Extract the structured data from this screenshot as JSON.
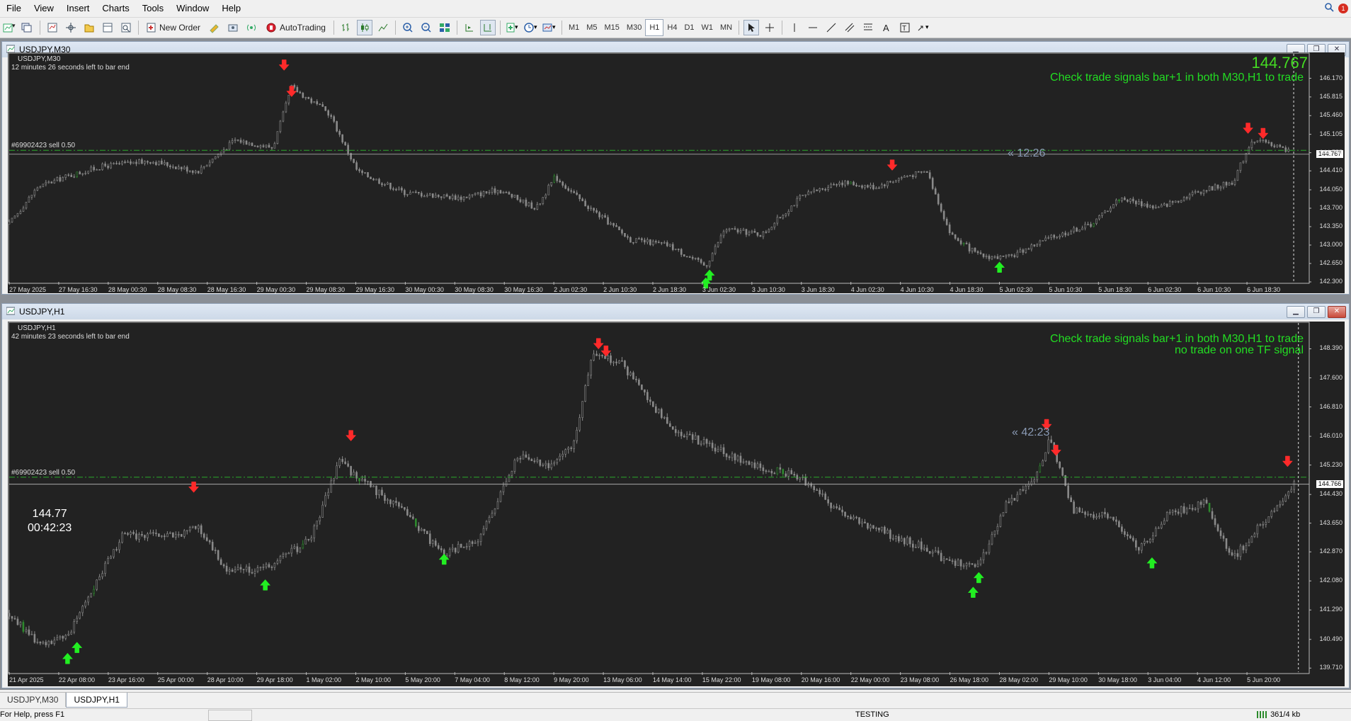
{
  "menu": [
    "File",
    "View",
    "Insert",
    "Charts",
    "Tools",
    "Window",
    "Help"
  ],
  "toolbar": {
    "new_order": "New Order",
    "autotrading": "AutoTrading",
    "timeframes": [
      "M1",
      "M5",
      "M15",
      "M30",
      "H1",
      "H4",
      "D1",
      "W1",
      "MN"
    ],
    "active_timeframe": "H1",
    "notification_count": "1"
  },
  "windows": [
    {
      "title": "USDJPY,M30",
      "symbol": "USDJPY,M30",
      "time_left": "12 minutes 26 seconds left to bar end",
      "order_label": "#69902423 sell 0.50",
      "big_price": "144.767",
      "signal_lines": [
        "Check trade signals bar+1 in both M30,H1 to trade"
      ],
      "countdown": "« 12:26",
      "current_price_tag": "144.767",
      "price_axis": [
        "146.170",
        "145.815",
        "145.460",
        "145.105",
        "144.755",
        "144.410",
        "144.050",
        "143.700",
        "143.350",
        "143.000",
        "142.650",
        "142.300"
      ],
      "time_axis": [
        "27 May 2025",
        "27 May 16:30",
        "28 May 00:30",
        "28 May 08:30",
        "28 May 16:30",
        "29 May 00:30",
        "29 May 08:30",
        "29 May 16:30",
        "30 May 00:30",
        "30 May 08:30",
        "30 May 16:30",
        "2 Jun 02:30",
        "2 Jun 10:30",
        "2 Jun 18:30",
        "3 Jun 02:30",
        "3 Jun 10:30",
        "3 Jun 18:30",
        "4 Jun 02:30",
        "4 Jun 10:30",
        "4 Jun 18:30",
        "5 Jun 02:30",
        "5 Jun 10:30",
        "5 Jun 18:30",
        "6 Jun 02:30",
        "6 Jun 10:30",
        "6 Jun 18:30"
      ],
      "corner_price": "",
      "corner_time": ""
    },
    {
      "title": "USDJPY,H1",
      "symbol": "USDJPY,H1",
      "time_left": "42 minutes 23 seconds left to bar end",
      "order_label": "#69902423 sell 0.50",
      "big_price": "",
      "signal_lines": [
        "Check trade signals bar+1 in both M30,H1 to trade",
        "no trade on one TF signal"
      ],
      "countdown": "« 42:23",
      "current_price_tag": "144.766",
      "price_axis": [
        "148.390",
        "147.600",
        "146.810",
        "146.010",
        "145.230",
        "144.430",
        "143.650",
        "142.870",
        "142.080",
        "141.290",
        "140.490",
        "139.710"
      ],
      "time_axis": [
        "21 Apr 2025",
        "22 Apr 08:00",
        "23 Apr 16:00",
        "25 Apr 00:00",
        "28 Apr 10:00",
        "29 Apr 18:00",
        "1 May 02:00",
        "2 May 10:00",
        "5 May 20:00",
        "7 May 04:00",
        "8 May 12:00",
        "9 May 20:00",
        "13 May 06:00",
        "14 May 14:00",
        "15 May 22:00",
        "19 May 08:00",
        "20 May 16:00",
        "22 May 00:00",
        "23 May 08:00",
        "26 May 18:00",
        "28 May 02:00",
        "29 May 10:00",
        "30 May 18:00",
        "3 Jun 04:00",
        "4 Jun 12:00",
        "5 Jun 20:00"
      ],
      "corner_price": "144.77",
      "corner_time": "00:42:23"
    }
  ],
  "tabs": [
    "USDJPY,M30",
    "USDJPY,H1"
  ],
  "status": {
    "help": "For Help, press F1",
    "mode": "TESTING",
    "traffic": "361/4 kb"
  },
  "chart_data": [
    {
      "type": "candlestick",
      "symbol": "USDJPY",
      "timeframe": "M30",
      "ylim": [
        142.3,
        146.5
      ],
      "y_ticks": [
        146.17,
        145.815,
        145.46,
        145.105,
        144.755,
        144.41,
        144.05,
        143.7,
        143.35,
        143.0,
        142.65,
        142.3
      ],
      "x_tick_labels": [
        "27 May 2025",
        "27 May 16:30",
        "28 May 00:30",
        "28 May 08:30",
        "28 May 16:30",
        "29 May 00:30",
        "29 May 08:30",
        "29 May 16:30",
        "30 May 00:30",
        "30 May 08:30",
        "30 May 16:30",
        "2 Jun 02:30",
        "2 Jun 10:30",
        "2 Jun 18:30",
        "3 Jun 02:30",
        "3 Jun 10:30",
        "3 Jun 18:30",
        "4 Jun 02:30",
        "4 Jun 10:30",
        "4 Jun 18:30",
        "5 Jun 02:30",
        "5 Jun 10:30",
        "5 Jun 18:30",
        "6 Jun 02:30",
        "6 Jun 10:30",
        "6 Jun 18:30"
      ],
      "price_path": [
        [
          0,
          143.4
        ],
        [
          30,
          144.1
        ],
        [
          60,
          144.3
        ],
        [
          100,
          144.5
        ],
        [
          150,
          144.6
        ],
        [
          200,
          144.4
        ],
        [
          240,
          145.0
        ],
        [
          280,
          144.85
        ],
        [
          300,
          146.0
        ],
        [
          340,
          145.5
        ],
        [
          370,
          144.4
        ],
        [
          420,
          144.0
        ],
        [
          480,
          143.9
        ],
        [
          520,
          144.05
        ],
        [
          560,
          143.7
        ],
        [
          580,
          144.3
        ],
        [
          610,
          143.8
        ],
        [
          660,
          143.1
        ],
        [
          700,
          143.0
        ],
        [
          740,
          142.6
        ],
        [
          760,
          143.3
        ],
        [
          800,
          143.2
        ],
        [
          840,
          143.9
        ],
        [
          880,
          144.2
        ],
        [
          920,
          144.1
        ],
        [
          950,
          144.3
        ],
        [
          975,
          144.4
        ],
        [
          1000,
          143.2
        ],
        [
          1030,
          142.8
        ],
        [
          1060,
          142.75
        ],
        [
          1100,
          143.1
        ],
        [
          1150,
          143.4
        ],
        [
          1180,
          143.9
        ],
        [
          1220,
          143.7
        ],
        [
          1260,
          144.0
        ],
        [
          1300,
          144.2
        ],
        [
          1320,
          145.0
        ],
        [
          1345,
          144.9
        ],
        [
          1360,
          144.77
        ]
      ],
      "order_line": 144.8,
      "current_price": 144.767,
      "signals": [
        {
          "type": "sell",
          "x": 292,
          "y": 146.4
        },
        {
          "type": "sell",
          "x": 300,
          "y": 145.9
        },
        {
          "type": "sell",
          "x": 938,
          "y": 144.5
        },
        {
          "type": "buy",
          "x": 744,
          "y": 142.45
        },
        {
          "type": "buy",
          "x": 740,
          "y": 142.3
        },
        {
          "type": "buy",
          "x": 1052,
          "y": 142.6
        },
        {
          "type": "sell",
          "x": 1316,
          "y": 145.2
        },
        {
          "type": "sell",
          "x": 1332,
          "y": 145.1
        }
      ]
    },
    {
      "type": "candlestick",
      "symbol": "USDJPY",
      "timeframe": "H1",
      "ylim": [
        139.6,
        148.9
      ],
      "y_ticks": [
        148.39,
        147.6,
        146.81,
        146.01,
        145.23,
        144.43,
        143.65,
        142.87,
        142.08,
        141.29,
        140.49,
        139.71
      ],
      "x_tick_labels": [
        "21 Apr 2025",
        "22 Apr 08:00",
        "23 Apr 16:00",
        "25 Apr 00:00",
        "28 Apr 10:00",
        "29 Apr 18:00",
        "1 May 02:00",
        "2 May 10:00",
        "5 May 20:00",
        "7 May 04:00",
        "8 May 12:00",
        "9 May 20:00",
        "13 May 06:00",
        "14 May 14:00",
        "15 May 22:00",
        "19 May 08:00",
        "20 May 16:00",
        "22 May 00:00",
        "23 May 08:00",
        "26 May 18:00",
        "28 May 02:00",
        "29 May 10:00",
        "30 May 18:00",
        "3 Jun 04:00",
        "4 Jun 12:00",
        "5 Jun 20:00"
      ],
      "price_path": [
        [
          0,
          141.2
        ],
        [
          30,
          140.4
        ],
        [
          60,
          140.5
        ],
        [
          80,
          141.5
        ],
        [
          120,
          143.3
        ],
        [
          180,
          143.3
        ],
        [
          200,
          143.6
        ],
        [
          230,
          142.4
        ],
        [
          270,
          142.4
        ],
        [
          320,
          143.2
        ],
        [
          350,
          145.3
        ],
        [
          380,
          144.7
        ],
        [
          420,
          144.0
        ],
        [
          460,
          142.8
        ],
        [
          500,
          143.2
        ],
        [
          540,
          145.5
        ],
        [
          570,
          145.2
        ],
        [
          600,
          145.8
        ],
        [
          620,
          148.3
        ],
        [
          650,
          148.0
        ],
        [
          700,
          146.3
        ],
        [
          740,
          145.8
        ],
        [
          780,
          145.3
        ],
        [
          840,
          144.9
        ],
        [
          880,
          144.0
        ],
        [
          930,
          143.4
        ],
        [
          970,
          143.0
        ],
        [
          1000,
          142.6
        ],
        [
          1030,
          142.5
        ],
        [
          1060,
          144.2
        ],
        [
          1090,
          144.8
        ],
        [
          1105,
          146.0
        ],
        [
          1130,
          144.0
        ],
        [
          1170,
          143.8
        ],
        [
          1200,
          142.9
        ],
        [
          1230,
          143.9
        ],
        [
          1270,
          144.2
        ],
        [
          1300,
          142.7
        ],
        [
          1340,
          143.9
        ],
        [
          1365,
          144.77
        ]
      ],
      "order_line": 144.9,
      "current_price": 144.766,
      "signals": [
        {
          "type": "buy",
          "x": 62,
          "y": 140.0
        },
        {
          "type": "buy",
          "x": 72,
          "y": 140.3
        },
        {
          "type": "sell",
          "x": 196,
          "y": 144.6
        },
        {
          "type": "buy",
          "x": 272,
          "y": 142.0
        },
        {
          "type": "sell",
          "x": 363,
          "y": 146.0
        },
        {
          "type": "buy",
          "x": 462,
          "y": 142.7
        },
        {
          "type": "sell",
          "x": 626,
          "y": 148.5
        },
        {
          "type": "sell",
          "x": 634,
          "y": 148.3
        },
        {
          "type": "buy",
          "x": 1024,
          "y": 141.8
        },
        {
          "type": "buy",
          "x": 1030,
          "y": 142.2
        },
        {
          "type": "sell",
          "x": 1102,
          "y": 146.3
        },
        {
          "type": "sell",
          "x": 1112,
          "y": 145.6
        },
        {
          "type": "buy",
          "x": 1214,
          "y": 142.6
        },
        {
          "type": "sell",
          "x": 1358,
          "y": 145.3
        }
      ]
    }
  ]
}
